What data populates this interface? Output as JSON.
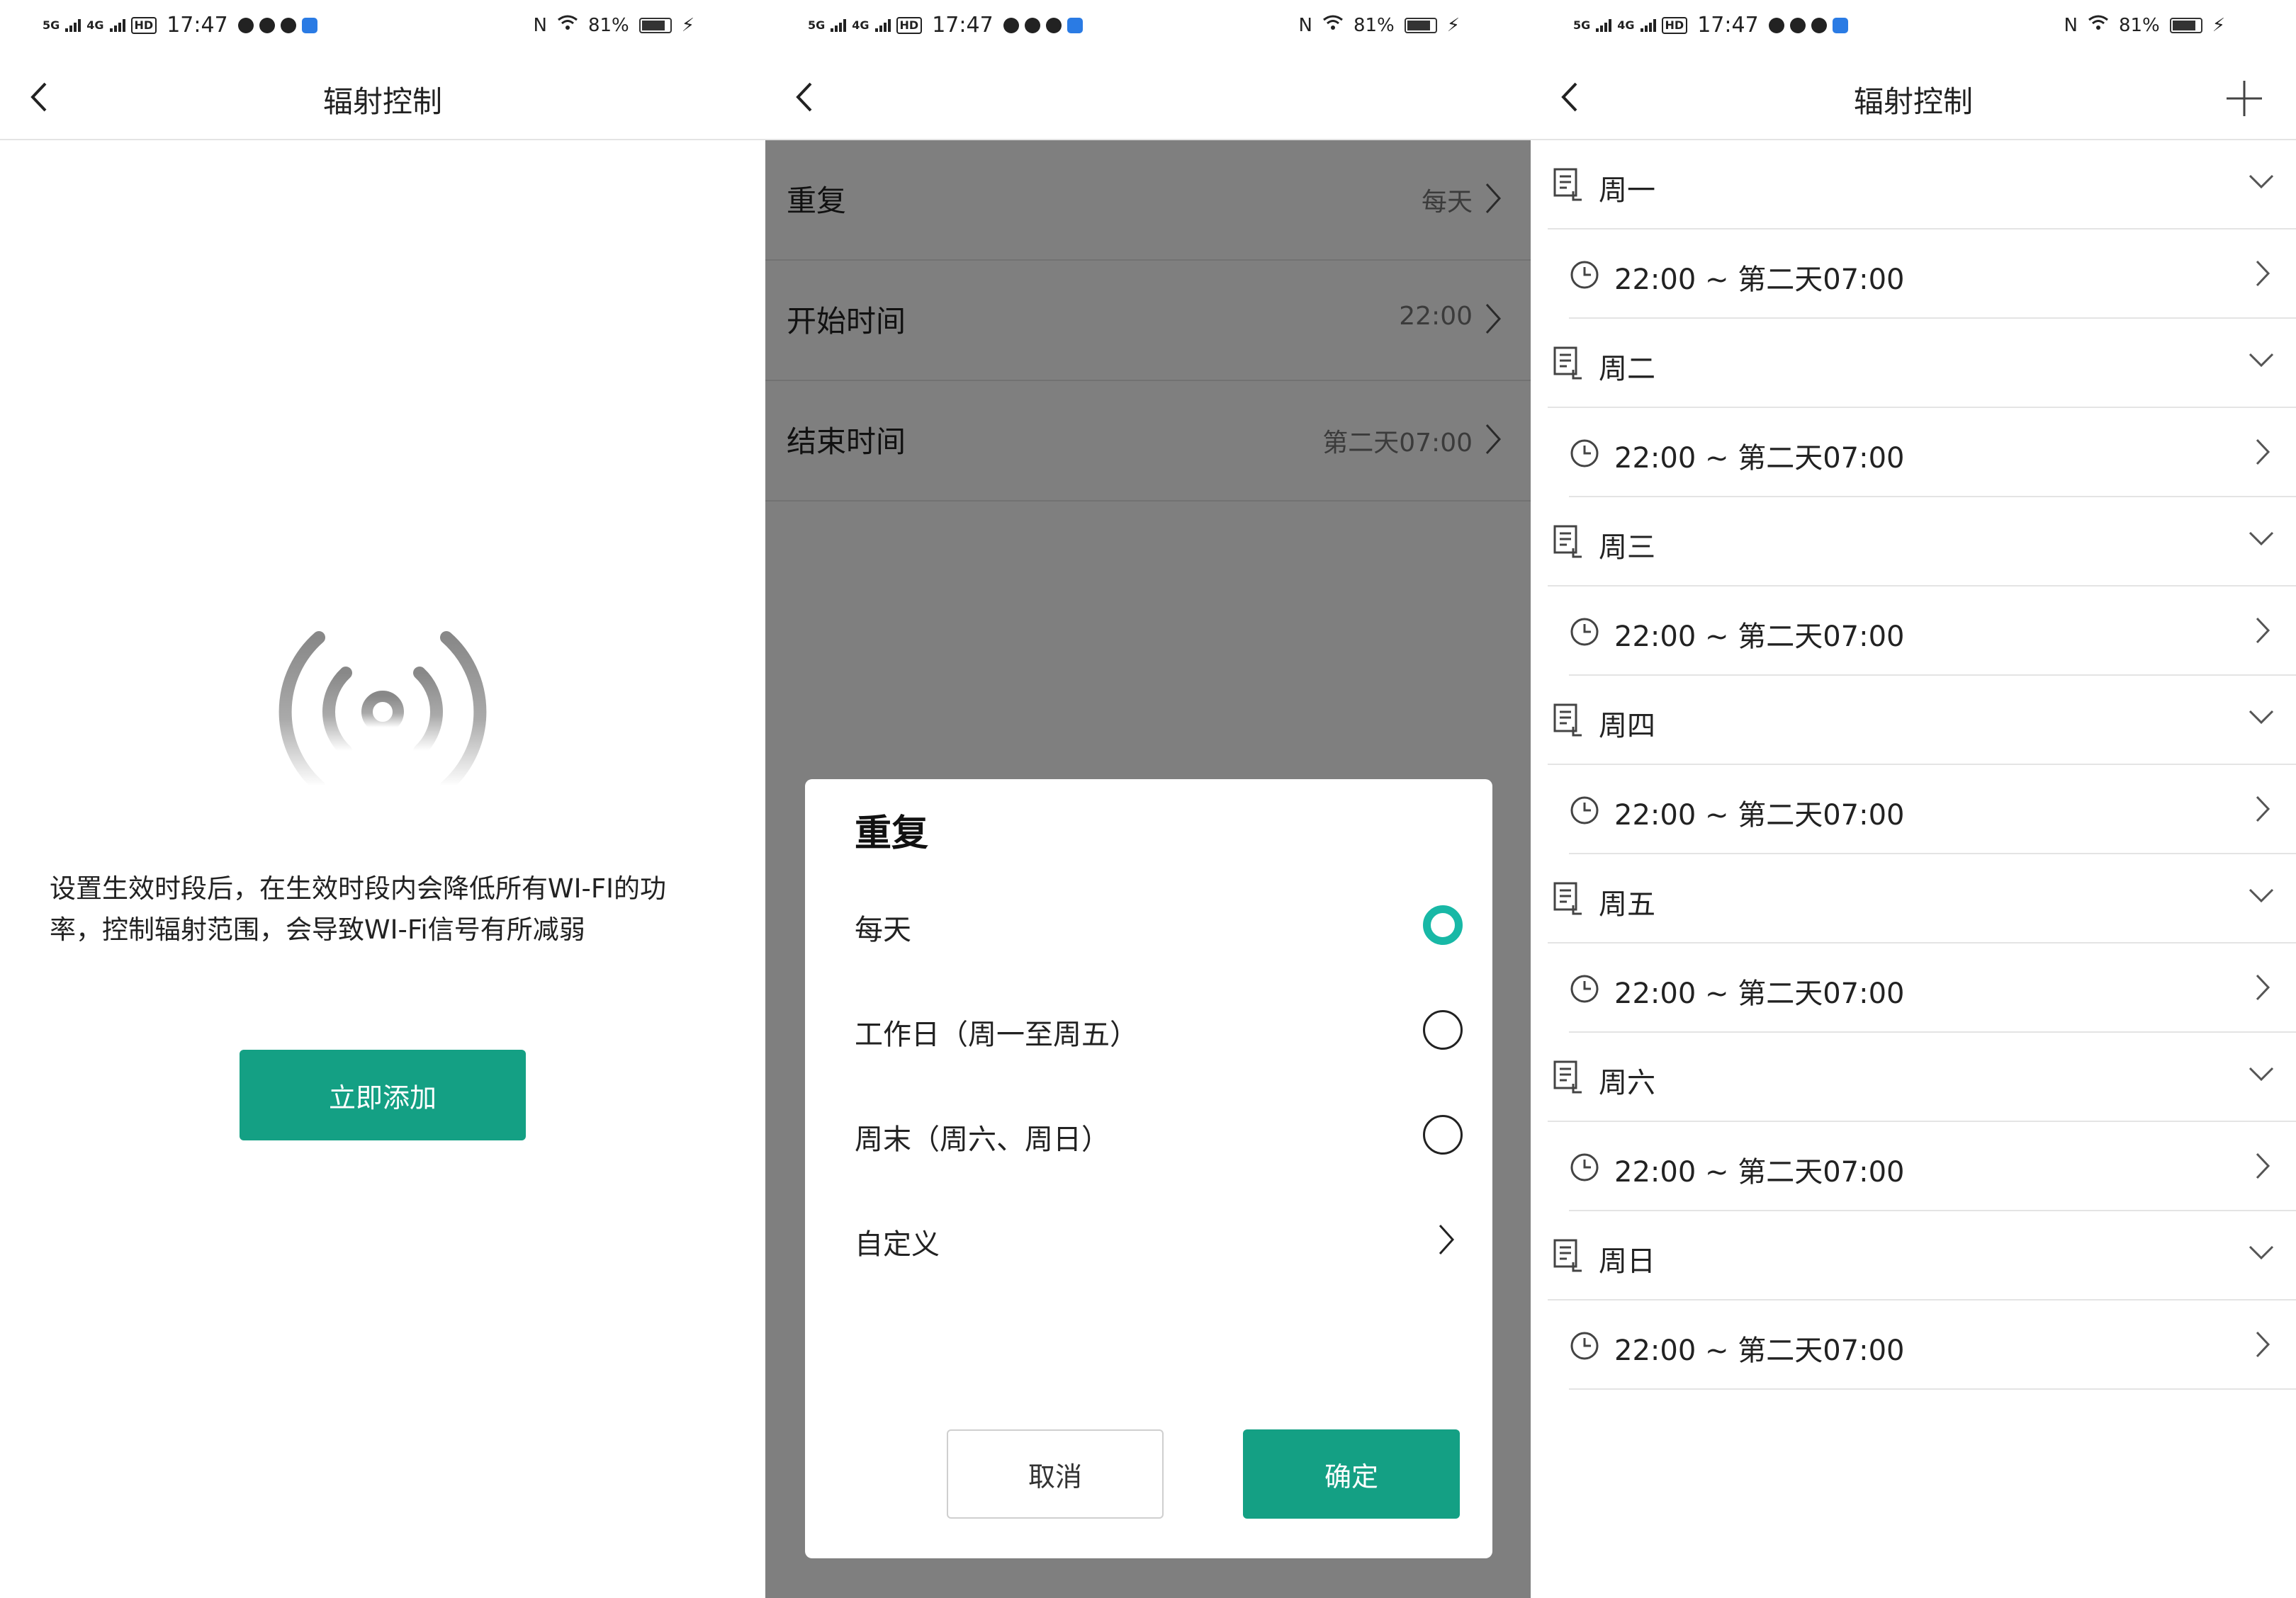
{
  "status_bar": {
    "time": "17:47",
    "battery": "81%",
    "net1": "5G",
    "net2": "4G",
    "hd": "HD"
  },
  "panel1": {
    "title": "辐射控制",
    "description": "设置生效时段后，在生效时段内会降低所有WI-FI的功率，控制辐射范围，会导致WI-Fi信号有所减弱",
    "add_button": "立即添加"
  },
  "panel2": {
    "rows": [
      {
        "label": "重复",
        "value": "每天"
      },
      {
        "label": "开始时间",
        "value": "22:00"
      },
      {
        "label": "结束时间",
        "value": "第二天07:00"
      }
    ],
    "dialog": {
      "title": "重复",
      "options": [
        {
          "label": "每天",
          "selected": true
        },
        {
          "label": "工作日（周一至周五）",
          "selected": false
        },
        {
          "label": "周末（周六、周日）",
          "selected": false
        },
        {
          "label": "自定义",
          "selected": false
        }
      ],
      "cancel": "取消",
      "ok": "确定"
    }
  },
  "panel3": {
    "title": "辐射控制",
    "days": [
      {
        "label": "周一",
        "slot": "22:00 ~ 第二天07:00"
      },
      {
        "label": "周二",
        "slot": "22:00 ~ 第二天07:00"
      },
      {
        "label": "周三",
        "slot": "22:00 ~ 第二天07:00"
      },
      {
        "label": "周四",
        "slot": "22:00 ~ 第二天07:00"
      },
      {
        "label": "周五",
        "slot": "22:00 ~ 第二天07:00"
      },
      {
        "label": "周六",
        "slot": "22:00 ~ 第二天07:00"
      },
      {
        "label": "周日",
        "slot": "22:00 ~ 第二天07:00"
      }
    ]
  },
  "colors": {
    "accent": "#14a084",
    "radio_on": "#18b8a6",
    "overlay": "#808080"
  }
}
